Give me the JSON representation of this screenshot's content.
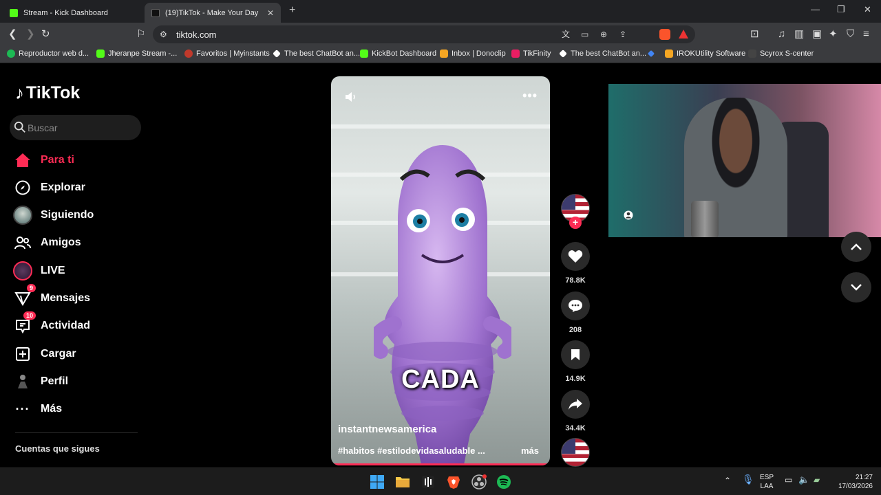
{
  "browser": {
    "tabs": [
      {
        "title": "Stream - Kick Dashboard"
      },
      {
        "title": "(19)TikTok - Make Your Day"
      }
    ],
    "url": "tiktok.com",
    "bookmarks": [
      {
        "label": "Reproductor web d...",
        "color": "#1db954"
      },
      {
        "label": "Jheranpe Stream -...",
        "color": "#53fc18"
      },
      {
        "label": "Favoritos | Myinstants",
        "color": "#c0392b"
      },
      {
        "label": "The best ChatBot an...",
        "color": "#ffffff"
      },
      {
        "label": "KickBot Dashboard",
        "color": "#53fc18"
      },
      {
        "label": "Inbox | Donoclip",
        "color": "#f5a623"
      },
      {
        "label": "TikFinity",
        "color": "#e91e63"
      },
      {
        "label": "The best ChatBot an...",
        "color": "#ffffff"
      },
      {
        "label": "",
        "color": "#4285f4"
      },
      {
        "label": "IROKUtility Software",
        "color": "#f5a623"
      },
      {
        "label": "Scyrox S-center",
        "color": "#444444"
      }
    ]
  },
  "tiktok": {
    "logo": "TikTok",
    "search_placeholder": "Buscar",
    "nav": [
      {
        "label": "Para ti",
        "icon": "home-icon",
        "badge": ""
      },
      {
        "label": "Explorar",
        "icon": "compass-icon",
        "badge": ""
      },
      {
        "label": "Siguiendo",
        "icon": "following-avatar-icon",
        "badge": ""
      },
      {
        "label": "Amigos",
        "icon": "friends-icon",
        "badge": ""
      },
      {
        "label": "LIVE",
        "icon": "live-icon",
        "badge": ""
      },
      {
        "label": "Mensajes",
        "icon": "messages-icon",
        "badge": "9"
      },
      {
        "label": "Actividad",
        "icon": "activity-icon",
        "badge": "10"
      },
      {
        "label": "Cargar",
        "icon": "upload-icon",
        "badge": ""
      },
      {
        "label": "Perfil",
        "icon": "profile-icon",
        "badge": ""
      },
      {
        "label": "Más",
        "icon": "more-icon",
        "badge": ""
      }
    ],
    "section_following": "Cuentas que sigues",
    "video": {
      "caption": "CADA",
      "author": "instantnewsamerica",
      "tags": "#habitos #estilodevidasaludable ...",
      "more": "más"
    },
    "actions": {
      "likes": "78.8K",
      "comments": "208",
      "saves": "14.9K",
      "shares": "34.4K"
    }
  },
  "taskbar": {
    "lang_top": "ESP",
    "lang_bottom": "LAA",
    "time": "21:27",
    "date": "17/03/2026"
  },
  "colors": {
    "accent": "#fe2c55",
    "background": "#000000"
  }
}
